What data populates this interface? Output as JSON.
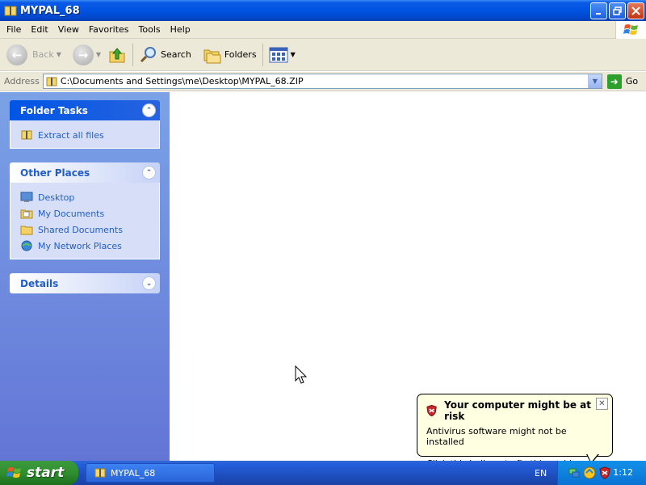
{
  "window": {
    "title": "MYPAL_68"
  },
  "menu": [
    "File",
    "Edit",
    "View",
    "Favorites",
    "Tools",
    "Help"
  ],
  "toolbar": {
    "back": "Back",
    "search": "Search",
    "folders": "Folders"
  },
  "address": {
    "label": "Address",
    "path": "C:\\Documents and Settings\\me\\Desktop\\MYPAL_68.ZIP",
    "go": "Go"
  },
  "folder_tasks": {
    "title": "Folder Tasks",
    "items": [
      {
        "label": "Extract all files",
        "icon": "extract-icon"
      }
    ]
  },
  "other_places": {
    "title": "Other Places",
    "items": [
      {
        "label": "Desktop",
        "icon": "desktop-icon"
      },
      {
        "label": "My Documents",
        "icon": "documents-folder-icon"
      },
      {
        "label": "Shared Documents",
        "icon": "folder-icon"
      },
      {
        "label": "My Network Places",
        "icon": "network-icon"
      }
    ]
  },
  "details": {
    "title": "Details"
  },
  "balloon": {
    "title": "Your computer might be at risk",
    "line1": "Antivirus software might not be installed",
    "line2": "Click this balloon to fix this problem."
  },
  "taskbar": {
    "start": "start",
    "task_label": "MYPAL_68",
    "language": "EN",
    "clock": "1:12"
  }
}
